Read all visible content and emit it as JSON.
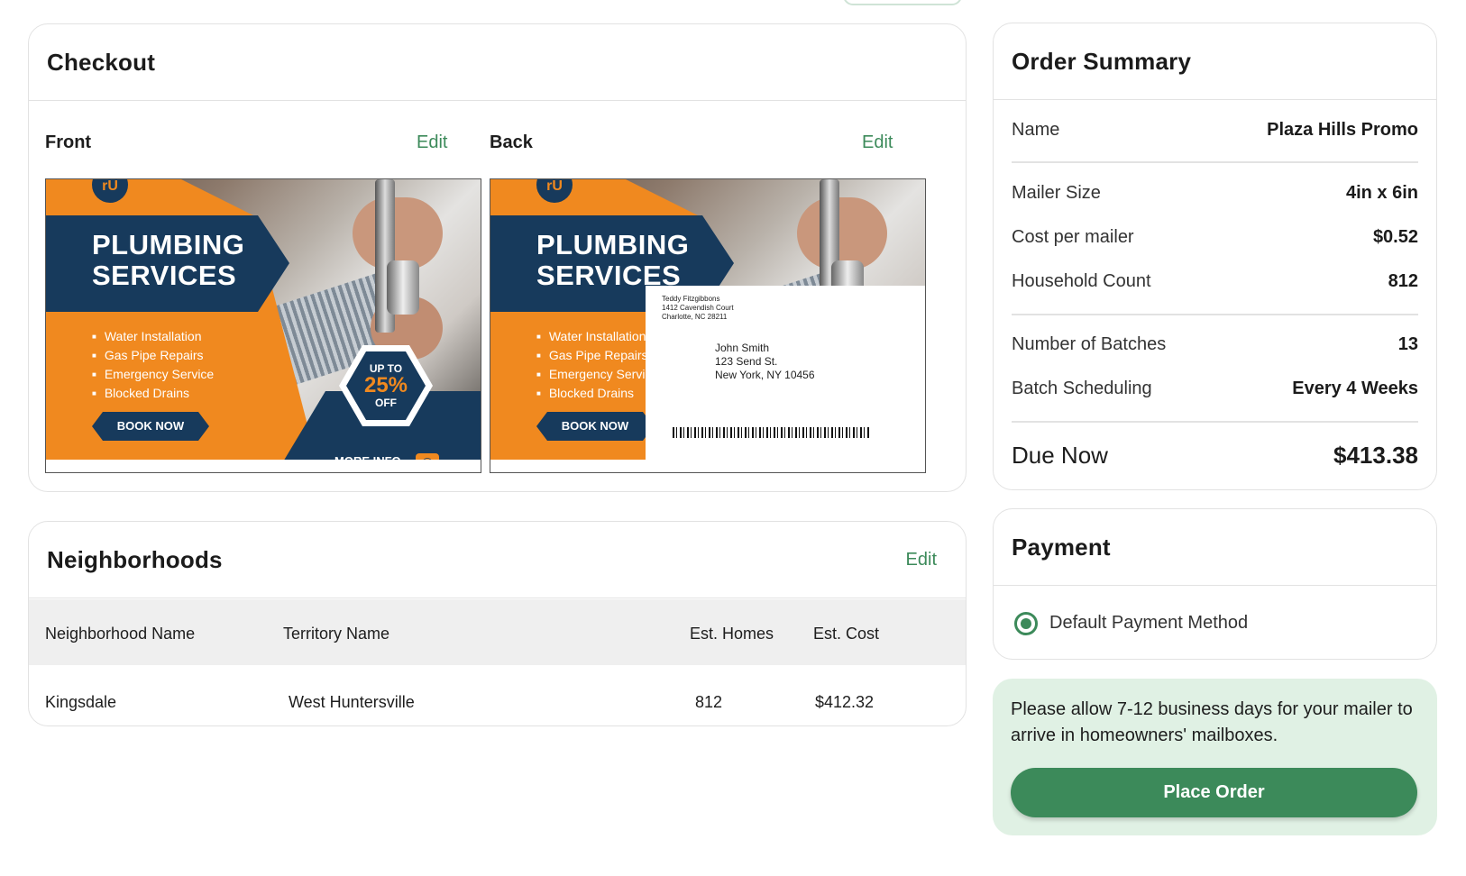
{
  "checkout": {
    "title": "Checkout",
    "front": {
      "label": "Front",
      "edit": "Edit"
    },
    "back": {
      "label": "Back",
      "edit": "Edit"
    },
    "mailer": {
      "logo": "rU",
      "headline_line1": "PLUMBING",
      "headline_line2": "SERVICES",
      "bullets": [
        "Water Installation",
        "Gas Pipe Repairs",
        "Emergency Service",
        "Blocked Drains"
      ],
      "cta": "BOOK NOW",
      "promo_top": "UP TO",
      "promo_value": "25%",
      "promo_bottom": "OFF",
      "more_info": "MORE INFO"
    },
    "address": {
      "return_name": "Teddy Fitzgibbons",
      "return_street": "1412 Cavendish Court",
      "return_city": "Charlotte, NC 28211",
      "recipient_name": "John Smith",
      "recipient_street": "123 Send St.",
      "recipient_city": "New York, NY 10456"
    }
  },
  "neighborhoods": {
    "title": "Neighborhoods",
    "edit": "Edit",
    "columns": [
      "Neighborhood Name",
      "Territory Name",
      "Est. Homes",
      "Est. Cost"
    ],
    "rows": [
      {
        "neighborhood": "Kingsdale",
        "territory": "West Huntersville",
        "homes": "812",
        "cost": "$412.32"
      }
    ]
  },
  "summary": {
    "title": "Order Summary",
    "name_label": "Name",
    "name_value": "Plaza Hills Promo",
    "size_label": "Mailer Size",
    "size_value": "4in x 6in",
    "cost_label": "Cost per mailer",
    "cost_value": "$0.52",
    "count_label": "Household Count",
    "count_value": "812",
    "batches_label": "Number of Batches",
    "batches_value": "13",
    "scheduling_label": "Batch Scheduling",
    "scheduling_value": "Every 4 Weeks",
    "due_label": "Due Now",
    "due_value": "$413.38"
  },
  "payment": {
    "title": "Payment",
    "method_label": "Default Payment Method",
    "method_selected": true
  },
  "notice": {
    "text": "Please allow 7-12 business days for your mailer to arrive in homeowners' mailboxes.",
    "button": "Place Order"
  },
  "colors": {
    "accent_green": "#3c8a5a",
    "notice_bg": "#e0f1e4",
    "mailer_orange": "#f0891f",
    "mailer_navy": "#173a5c"
  }
}
